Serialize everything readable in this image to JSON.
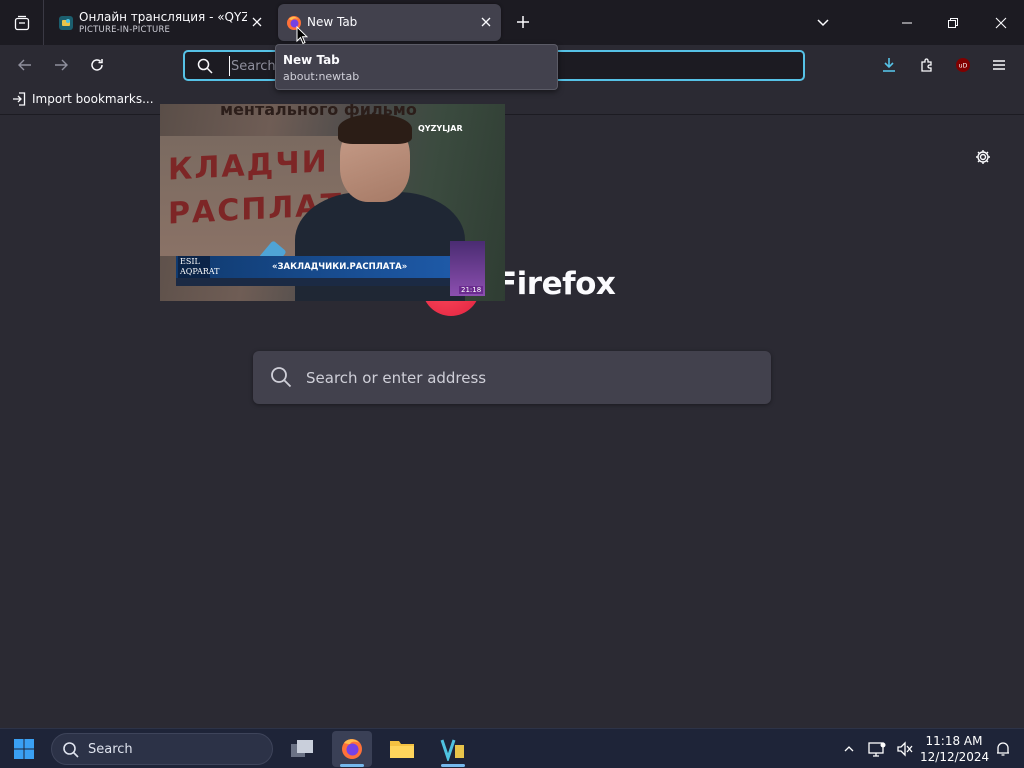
{
  "browser": {
    "tabs": [
      {
        "title": "Онлайн трансляция - «QYZYLJ",
        "subtitle": "PICTURE-IN-PICTURE",
        "active": false
      },
      {
        "title": "New Tab",
        "active": true
      }
    ],
    "tooltip": {
      "title": "New Tab",
      "url": "about:newtab"
    },
    "urlbar": {
      "placeholder": "Search or enter address",
      "visible_placeholder": "Search"
    },
    "bookmarks": {
      "import_label": "Import bookmarks..."
    },
    "accent_color": "#56c2e6"
  },
  "newtab": {
    "wordmark": "Firefox",
    "search_placeholder": "Search or enter address"
  },
  "pip_video": {
    "sign_text": "КЛАДЧИ\nРАСПЛАТ",
    "top_text": "ментального фильмо",
    "channel": "QYZYLJAR",
    "lower_third": "«ЗАКЛАДЧИКИ.РАСПЛАТА»",
    "esil": "ESIL\nAQPARAT",
    "time": "21:18"
  },
  "taskbar": {
    "search_label": "Search",
    "time": "11:18 AM",
    "date": "12/12/2024"
  }
}
